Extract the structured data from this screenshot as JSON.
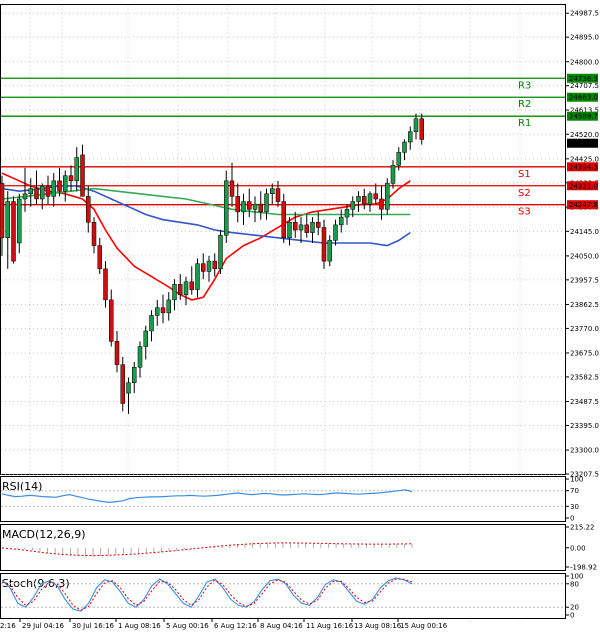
{
  "chart_data": {
    "type": "candlestick",
    "main": {
      "ylim": [
        23207.5,
        25000
      ],
      "yticks": [
        "24987.5",
        "24895.0",
        "24800.0",
        "24707.5",
        "24613.5",
        "24520.0",
        "24425.0",
        "24332.5",
        "24238.5",
        "24145.0",
        "24050.0",
        "23957.5",
        "23862.5",
        "23770.0",
        "23675.0",
        "23582.5",
        "23487.5",
        "23395.0",
        "23300.0",
        "23207.5"
      ],
      "candles": [
        {
          "o": 24330,
          "h": 24360,
          "l": 24050,
          "c": 24120
        },
        {
          "o": 24120,
          "h": 24300,
          "l": 24000,
          "c": 24260
        },
        {
          "o": 24260,
          "h": 24280,
          "l": 24020,
          "c": 24030
        },
        {
          "o": 24100,
          "h": 24290,
          "l": 24060,
          "c": 24270
        },
        {
          "o": 24270,
          "h": 24390,
          "l": 24220,
          "c": 24290
        },
        {
          "o": 24290,
          "h": 24350,
          "l": 24240,
          "c": 24310
        },
        {
          "o": 24310,
          "h": 24380,
          "l": 24250,
          "c": 24270
        },
        {
          "o": 24270,
          "h": 24330,
          "l": 24230,
          "c": 24320
        },
        {
          "o": 24320,
          "h": 24360,
          "l": 24250,
          "c": 24280
        },
        {
          "o": 24280,
          "h": 24370,
          "l": 24240,
          "c": 24340
        },
        {
          "o": 24340,
          "h": 24390,
          "l": 24280,
          "c": 24300
        },
        {
          "o": 24300,
          "h": 24380,
          "l": 24260,
          "c": 24360
        },
        {
          "o": 24360,
          "h": 24400,
          "l": 24300,
          "c": 24340
        },
        {
          "o": 24340,
          "h": 24470,
          "l": 24300,
          "c": 24430
        },
        {
          "o": 24440,
          "h": 24480,
          "l": 24300,
          "c": 24280
        },
        {
          "o": 24280,
          "h": 24320,
          "l": 24140,
          "c": 24180
        },
        {
          "o": 24180,
          "h": 24200,
          "l": 24060,
          "c": 24090
        },
        {
          "o": 24090,
          "h": 24120,
          "l": 23980,
          "c": 24000
        },
        {
          "o": 24000,
          "h": 24030,
          "l": 23850,
          "c": 23880
        },
        {
          "o": 23880,
          "h": 23920,
          "l": 23700,
          "c": 23720
        },
        {
          "o": 23720,
          "h": 23760,
          "l": 23600,
          "c": 23630
        },
        {
          "o": 23630,
          "h": 23660,
          "l": 23450,
          "c": 23480
        },
        {
          "o": 23520,
          "h": 23580,
          "l": 23440,
          "c": 23560
        },
        {
          "o": 23560,
          "h": 23640,
          "l": 23520,
          "c": 23620
        },
        {
          "o": 23620,
          "h": 23720,
          "l": 23580,
          "c": 23700
        },
        {
          "o": 23700,
          "h": 23780,
          "l": 23650,
          "c": 23760
        },
        {
          "o": 23760,
          "h": 23840,
          "l": 23720,
          "c": 23820
        },
        {
          "o": 23820,
          "h": 23880,
          "l": 23780,
          "c": 23850
        },
        {
          "o": 23850,
          "h": 23900,
          "l": 23790,
          "c": 23830
        },
        {
          "o": 23830,
          "h": 23910,
          "l": 23800,
          "c": 23880
        },
        {
          "o": 23880,
          "h": 23960,
          "l": 23840,
          "c": 23940
        },
        {
          "o": 23940,
          "h": 23980,
          "l": 23880,
          "c": 23900
        },
        {
          "o": 23900,
          "h": 23970,
          "l": 23860,
          "c": 23950
        },
        {
          "o": 23950,
          "h": 24010,
          "l": 23900,
          "c": 23920
        },
        {
          "o": 23920,
          "h": 24040,
          "l": 23890,
          "c": 24020
        },
        {
          "o": 24020,
          "h": 24060,
          "l": 23960,
          "c": 23990
        },
        {
          "o": 23990,
          "h": 24050,
          "l": 23950,
          "c": 24030
        },
        {
          "o": 24030,
          "h": 24060,
          "l": 23970,
          "c": 24000
        },
        {
          "o": 24000,
          "h": 24150,
          "l": 23980,
          "c": 24130
        },
        {
          "o": 24130,
          "h": 24380,
          "l": 24100,
          "c": 24340
        },
        {
          "o": 24340,
          "h": 24410,
          "l": 24240,
          "c": 24280
        },
        {
          "o": 24280,
          "h": 24330,
          "l": 24180,
          "c": 24220
        },
        {
          "o": 24220,
          "h": 24290,
          "l": 24170,
          "c": 24260
        },
        {
          "o": 24260,
          "h": 24310,
          "l": 24200,
          "c": 24230
        },
        {
          "o": 24230,
          "h": 24280,
          "l": 24180,
          "c": 24250
        },
        {
          "o": 24250,
          "h": 24300,
          "l": 24190,
          "c": 24220
        },
        {
          "o": 24220,
          "h": 24310,
          "l": 24190,
          "c": 24290
        },
        {
          "o": 24290,
          "h": 24330,
          "l": 24250,
          "c": 24310
        },
        {
          "o": 24310,
          "h": 24340,
          "l": 24240,
          "c": 24260
        },
        {
          "o": 24260,
          "h": 24290,
          "l": 24100,
          "c": 24120
        },
        {
          "o": 24120,
          "h": 24200,
          "l": 24090,
          "c": 24180
        },
        {
          "o": 24180,
          "h": 24220,
          "l": 24120,
          "c": 24150
        },
        {
          "o": 24150,
          "h": 24200,
          "l": 24100,
          "c": 24170
        },
        {
          "o": 24170,
          "h": 24210,
          "l": 24120,
          "c": 24140
        },
        {
          "o": 24140,
          "h": 24200,
          "l": 24100,
          "c": 24180
        },
        {
          "o": 24180,
          "h": 24220,
          "l": 24130,
          "c": 24160
        },
        {
          "o": 24160,
          "h": 24190,
          "l": 24000,
          "c": 24030
        },
        {
          "o": 24030,
          "h": 24130,
          "l": 24010,
          "c": 24110
        },
        {
          "o": 24110,
          "h": 24190,
          "l": 24090,
          "c": 24170
        },
        {
          "o": 24170,
          "h": 24230,
          "l": 24140,
          "c": 24200
        },
        {
          "o": 24200,
          "h": 24250,
          "l": 24170,
          "c": 24230
        },
        {
          "o": 24230,
          "h": 24280,
          "l": 24200,
          "c": 24260
        },
        {
          "o": 24260,
          "h": 24300,
          "l": 24220,
          "c": 24280
        },
        {
          "o": 24280,
          "h": 24310,
          "l": 24230,
          "c": 24250
        },
        {
          "o": 24250,
          "h": 24300,
          "l": 24220,
          "c": 24290
        },
        {
          "o": 24290,
          "h": 24330,
          "l": 24250,
          "c": 24270
        },
        {
          "o": 24270,
          "h": 24320,
          "l": 24190,
          "c": 24230
        },
        {
          "o": 24230,
          "h": 24350,
          "l": 24210,
          "c": 24330
        },
        {
          "o": 24330,
          "h": 24420,
          "l": 24310,
          "c": 24400
        },
        {
          "o": 24400,
          "h": 24470,
          "l": 24380,
          "c": 24450
        },
        {
          "o": 24450,
          "h": 24500,
          "l": 24420,
          "c": 24490
        },
        {
          "o": 24490,
          "h": 24550,
          "l": 24460,
          "c": 24530
        },
        {
          "o": 24530,
          "h": 24600,
          "l": 24500,
          "c": 24580
        },
        {
          "o": 24580,
          "h": 24600,
          "l": 24480,
          "c": 24500
        }
      ],
      "moving_averages": [
        {
          "color": "#ff0000",
          "points": [
            [
              0,
              24370
            ],
            [
              2,
              24350
            ],
            [
              5,
              24320
            ],
            [
              8,
              24300
            ],
            [
              11,
              24290
            ],
            [
              14,
              24270
            ],
            [
              16,
              24230
            ],
            [
              18,
              24150
            ],
            [
              20,
              24080
            ],
            [
              23,
              24010
            ],
            [
              26,
              23970
            ],
            [
              29,
              23930
            ],
            [
              31,
              23900
            ],
            [
              33,
              23880
            ],
            [
              35,
              23890
            ],
            [
              37,
              23960
            ],
            [
              39,
              24040
            ],
            [
              42,
              24090
            ],
            [
              45,
              24120
            ],
            [
              48,
              24160
            ],
            [
              51,
              24200
            ],
            [
              54,
              24220
            ],
            [
              57,
              24230
            ],
            [
              60,
              24240
            ],
            [
              63,
              24250
            ],
            [
              65,
              24250
            ],
            [
              67,
              24270
            ],
            [
              69,
              24310
            ],
            [
              71,
              24340
            ]
          ]
        },
        {
          "color": "#3355cc",
          "points": [
            [
              0,
              24310
            ],
            [
              3,
              24300
            ],
            [
              7,
              24310
            ],
            [
              10,
              24320
            ],
            [
              13,
              24320
            ],
            [
              16,
              24300
            ],
            [
              19,
              24270
            ],
            [
              22,
              24240
            ],
            [
              25,
              24210
            ],
            [
              28,
              24190
            ],
            [
              31,
              24180
            ],
            [
              34,
              24170
            ],
            [
              37,
              24150
            ],
            [
              40,
              24140
            ],
            [
              44,
              24130
            ],
            [
              48,
              24120
            ],
            [
              52,
              24110
            ],
            [
              56,
              24100
            ],
            [
              60,
              24100
            ],
            [
              64,
              24100
            ],
            [
              67,
              24090
            ],
            [
              69,
              24110
            ],
            [
              71,
              24140
            ]
          ]
        },
        {
          "color": "#33aa55",
          "points": [
            [
              0,
              24270
            ],
            [
              4,
              24280
            ],
            [
              8,
              24290
            ],
            [
              12,
              24300
            ],
            [
              16,
              24310
            ],
            [
              20,
              24300
            ],
            [
              24,
              24290
            ],
            [
              28,
              24280
            ],
            [
              32,
              24270
            ],
            [
              36,
              24250
            ],
            [
              40,
              24230
            ],
            [
              44,
              24220
            ],
            [
              48,
              24210
            ],
            [
              52,
              24210
            ],
            [
              56,
              24210
            ],
            [
              60,
              24210
            ],
            [
              64,
              24210
            ],
            [
              68,
              24210
            ],
            [
              71,
              24210
            ]
          ]
        }
      ],
      "levels": [
        {
          "name": "R3",
          "value": 24736.3,
          "label": "24736.3",
          "color": "#008800"
        },
        {
          "name": "R2",
          "value": 24663.0,
          "label": "24663.0",
          "color": "#008800"
        },
        {
          "name": "R1",
          "value": 24589.7,
          "label": "24589.7",
          "color": "#008800"
        },
        {
          "name": "S1",
          "value": 24394.3,
          "label": "24394.3",
          "color": "#dd0000"
        },
        {
          "name": "S2",
          "value": 24321.0,
          "label": "24321.0",
          "color": "#dd0000"
        },
        {
          "name": "S3",
          "value": 24247.8,
          "label": "24247.8",
          "color": "#dd0000"
        }
      ],
      "current_price": {
        "value": 24485.3,
        "label": "24485.3"
      }
    },
    "rsi": {
      "label": "RSI(14)",
      "yticks": [
        "100",
        "70",
        "30",
        "0"
      ],
      "ylim": [
        0,
        100
      ],
      "values": [
        62,
        58,
        55,
        56,
        58,
        57,
        55,
        54,
        53,
        57,
        60,
        56,
        52,
        48,
        45,
        42,
        40,
        42,
        44,
        50,
        52,
        53,
        54,
        54,
        55,
        56,
        57,
        57,
        58,
        57,
        56,
        57,
        58,
        60,
        62,
        64,
        62,
        60,
        61,
        63,
        62,
        60,
        59,
        60,
        61,
        62,
        61,
        60,
        61,
        63,
        64,
        63,
        62,
        61,
        62,
        63,
        64,
        66,
        68,
        70,
        72,
        68
      ]
    },
    "macd": {
      "label": "MACD(12,26,9)",
      "yticks": [
        "215.22",
        "0.00",
        "-198.92"
      ],
      "ylim": [
        -198.92,
        215.22
      ],
      "histogram": [
        0,
        -5,
        -10,
        -20,
        -30,
        -40,
        -55,
        -70,
        -80,
        -85,
        -88,
        -90,
        -88,
        -85,
        -80,
        -75,
        -70,
        -65,
        -60,
        -55,
        -50,
        -45,
        -40,
        -30,
        -20,
        -10,
        0,
        10,
        20,
        28,
        35,
        40,
        45,
        50,
        52,
        55,
        56,
        55,
        54,
        52,
        50,
        48,
        46,
        44,
        42,
        40,
        38,
        36,
        35,
        34,
        35,
        36,
        37,
        38,
        40
      ],
      "signal": [
        -2,
        -8,
        -15,
        -25,
        -35,
        -45,
        -55,
        -62,
        -68,
        -73,
        -77,
        -80,
        -81,
        -80,
        -78,
        -75,
        -71,
        -67,
        -62,
        -56,
        -50,
        -43,
        -36,
        -28,
        -20,
        -12,
        -4,
        4,
        12,
        20,
        26,
        32,
        37,
        41,
        45,
        48,
        50,
        51,
        51,
        50,
        49,
        48,
        46,
        44,
        42,
        41,
        40,
        39,
        38,
        38,
        38,
        38,
        39,
        40,
        41
      ]
    },
    "stoch": {
      "label": "Stoch(9,6,3)",
      "yticks": [
        "100",
        "80",
        "20",
        "0"
      ],
      "ylim": [
        0,
        100
      ],
      "main": [
        90,
        70,
        30,
        20,
        45,
        80,
        88,
        75,
        40,
        15,
        10,
        30,
        70,
        90,
        85,
        60,
        30,
        20,
        40,
        75,
        92,
        80,
        55,
        30,
        20,
        50,
        85,
        92,
        70,
        40,
        25,
        20,
        35,
        65,
        88,
        92,
        80,
        50,
        30,
        25,
        45,
        78,
        90,
        85,
        60,
        35,
        28,
        40,
        70,
        88,
        95,
        90,
        80
      ],
      "signal": [
        85,
        75,
        45,
        25,
        35,
        65,
        85,
        80,
        55,
        25,
        12,
        22,
        55,
        82,
        88,
        70,
        42,
        25,
        35,
        62,
        86,
        84,
        65,
        40,
        25,
        40,
        72,
        90,
        78,
        52,
        32,
        22,
        30,
        55,
        80,
        90,
        84,
        60,
        38,
        28,
        38,
        68,
        86,
        87,
        68,
        45,
        32,
        36,
        60,
        82,
        92,
        92,
        85
      ]
    },
    "x_labels": [
      "29 Jul 04:16",
      "30 Jul 16:16",
      "1 Aug 08:16",
      "5 Aug 00:16",
      "6 Aug 12:16",
      "8 Aug 04:16",
      "11 Aug 16:16",
      "13 Aug 08:16",
      "15 Aug 00:16"
    ],
    "x_label_partial": "2:16"
  }
}
